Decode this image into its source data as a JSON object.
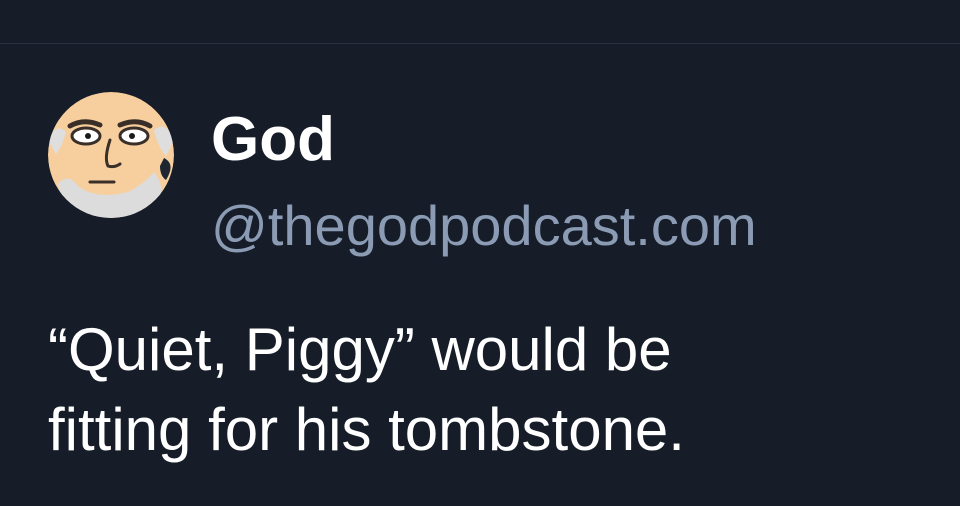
{
  "colors": {
    "background": "#161d29",
    "divider": "#2a323f",
    "name": "#ffffff",
    "handle": "#8a9bb3",
    "body_text": "#ffffff"
  },
  "author": {
    "avatar_icon": "cartoon-old-man-avatar",
    "display_name": "God",
    "handle": "@thegodpodcast.com"
  },
  "post": {
    "lines": [
      "“Quiet, Piggy” would be",
      "fitting for his tombstone."
    ]
  }
}
